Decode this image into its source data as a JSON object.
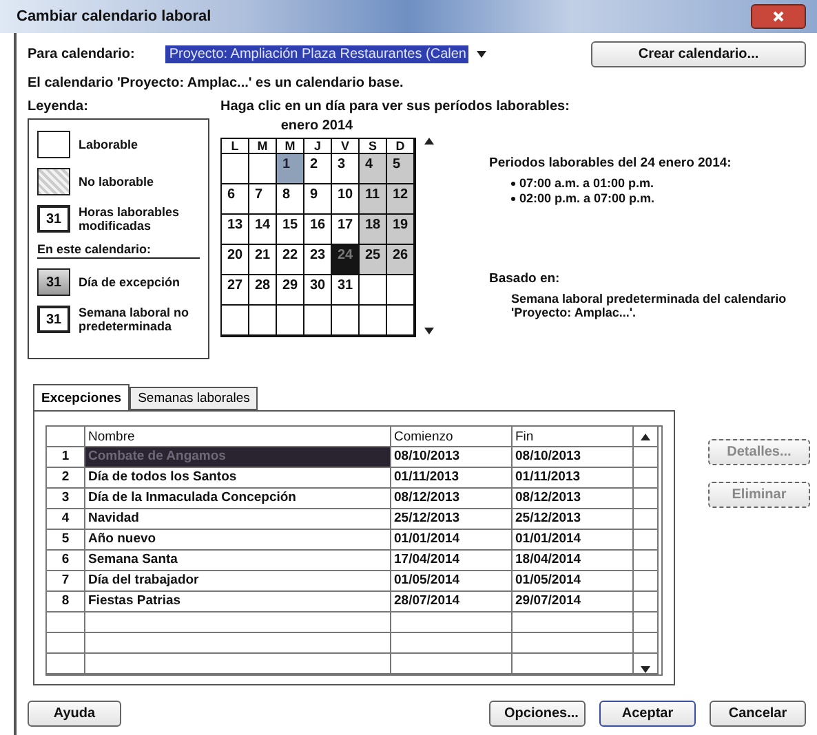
{
  "window": {
    "title": "Cambiar calendario laboral"
  },
  "calendar_select": {
    "label": "Para calendario:",
    "value": "Proyecto: Ampliación Plaza Restaurantes (Calen"
  },
  "create_button": "Crear calendario...",
  "info": "El calendario 'Proyecto: Amplac...' es un calendario base.",
  "legend": {
    "title": "Leyenda:",
    "items": [
      {
        "kind": "working",
        "label": "Laborable"
      },
      {
        "kind": "nonworking",
        "label": "No laborable"
      },
      {
        "kind": "modified",
        "sample": "31",
        "label": "Horas laborables modificadas"
      },
      {
        "kind": "heading",
        "label": "En este calendario:"
      },
      {
        "kind": "exception",
        "sample": "31",
        "label": "Día de excepción"
      },
      {
        "kind": "nondefault",
        "sample": "31",
        "label": "Semana laboral no predeterminada"
      }
    ]
  },
  "calendar": {
    "hint": "Haga clic en un día para ver sus períodos laborables:",
    "month": "enero 2014",
    "weekdays": [
      "L",
      "M",
      "M",
      "J",
      "V",
      "S",
      "D"
    ],
    "weeks": [
      [
        {
          "kind": "empty"
        },
        {
          "kind": "empty"
        },
        {
          "day": "1",
          "kind": "exception",
          "selected": false
        },
        {
          "day": "2",
          "kind": "working",
          "selected": false
        },
        {
          "day": "3",
          "kind": "working",
          "selected": false
        },
        {
          "day": "4",
          "kind": "nonworking",
          "selected": false
        },
        {
          "day": "5",
          "kind": "nonworking",
          "selected": false
        }
      ],
      [
        {
          "day": "6",
          "kind": "working",
          "selected": false
        },
        {
          "day": "7",
          "kind": "working",
          "selected": false
        },
        {
          "day": "8",
          "kind": "working",
          "selected": false
        },
        {
          "day": "9",
          "kind": "working",
          "selected": false
        },
        {
          "day": "10",
          "kind": "working",
          "selected": false
        },
        {
          "day": "11",
          "kind": "nonworking",
          "selected": false
        },
        {
          "day": "12",
          "kind": "nonworking",
          "selected": false
        }
      ],
      [
        {
          "day": "13",
          "kind": "working",
          "selected": false
        },
        {
          "day": "14",
          "kind": "working",
          "selected": false
        },
        {
          "day": "15",
          "kind": "working",
          "selected": false
        },
        {
          "day": "16",
          "kind": "working",
          "selected": false
        },
        {
          "day": "17",
          "kind": "working",
          "selected": false
        },
        {
          "day": "18",
          "kind": "nonworking",
          "selected": false
        },
        {
          "day": "19",
          "kind": "nonworking",
          "selected": false
        }
      ],
      [
        {
          "day": "20",
          "kind": "working",
          "selected": false
        },
        {
          "day": "21",
          "kind": "working",
          "selected": false
        },
        {
          "day": "22",
          "kind": "working",
          "selected": false
        },
        {
          "day": "23",
          "kind": "working",
          "selected": false
        },
        {
          "day": "24",
          "kind": "working",
          "selected": true
        },
        {
          "day": "25",
          "kind": "nonworking",
          "selected": false
        },
        {
          "day": "26",
          "kind": "nonworking",
          "selected": false
        }
      ],
      [
        {
          "day": "27",
          "kind": "working",
          "selected": false
        },
        {
          "day": "28",
          "kind": "working",
          "selected": false
        },
        {
          "day": "29",
          "kind": "working",
          "selected": false
        },
        {
          "day": "30",
          "kind": "working",
          "selected": false
        },
        {
          "day": "31",
          "kind": "working",
          "selected": false
        },
        {
          "kind": "empty"
        },
        {
          "kind": "empty"
        }
      ],
      [
        {
          "kind": "empty"
        },
        {
          "kind": "empty"
        },
        {
          "kind": "empty"
        },
        {
          "kind": "empty"
        },
        {
          "kind": "empty"
        },
        {
          "kind": "empty"
        },
        {
          "kind": "empty"
        }
      ]
    ]
  },
  "periods": {
    "title": "Periodos laborables del 24 enero 2014:",
    "items": [
      "07:00 a.m. a 01:00 p.m.",
      "02:00 p.m. a 07:00 p.m."
    ]
  },
  "based_on": {
    "title": "Basado en:",
    "text": "Semana laboral predeterminada del calendario 'Proyecto: Amplac...'."
  },
  "tabs": [
    {
      "label": "Excepciones",
      "selected": true
    },
    {
      "label": "Semanas laborales",
      "selected": false
    }
  ],
  "table": {
    "columns": [
      "Nombre",
      "Comienzo",
      "Fin"
    ],
    "rows": [
      {
        "number": "1",
        "name": "Combate de Angamos",
        "start": "08/10/2013",
        "end": "08/10/2013",
        "selected": true
      },
      {
        "number": "2",
        "name": "Día de todos los Santos",
        "start": "01/11/2013",
        "end": "01/11/2013",
        "selected": false
      },
      {
        "number": "3",
        "name": "Día de la Inmaculada Concepción",
        "start": "08/12/2013",
        "end": "08/12/2013",
        "selected": false
      },
      {
        "number": "4",
        "name": "Navidad",
        "start": "25/12/2013",
        "end": "25/12/2013",
        "selected": false
      },
      {
        "number": "5",
        "name": "Año nuevo",
        "start": "01/01/2014",
        "end": "01/01/2014",
        "selected": false
      },
      {
        "number": "6",
        "name": "Semana Santa",
        "start": "17/04/2014",
        "end": "18/04/2014",
        "selected": false
      },
      {
        "number": "7",
        "name": "Día del trabajador",
        "start": "01/05/2014",
        "end": "01/05/2014",
        "selected": false
      },
      {
        "number": "8",
        "name": "Fiestas Patrias",
        "start": "28/07/2014",
        "end": "29/07/2014",
        "selected": false
      }
    ]
  },
  "side_buttons": [
    {
      "label": "Detalles...",
      "disabled": true
    },
    {
      "label": "Eliminar",
      "disabled": true
    }
  ],
  "footer": {
    "help": "Ayuda",
    "buttons": [
      {
        "label": "Opciones...",
        "default": false
      },
      {
        "label": "Aceptar",
        "default": true
      },
      {
        "label": "Cancelar",
        "default": false
      }
    ]
  }
}
